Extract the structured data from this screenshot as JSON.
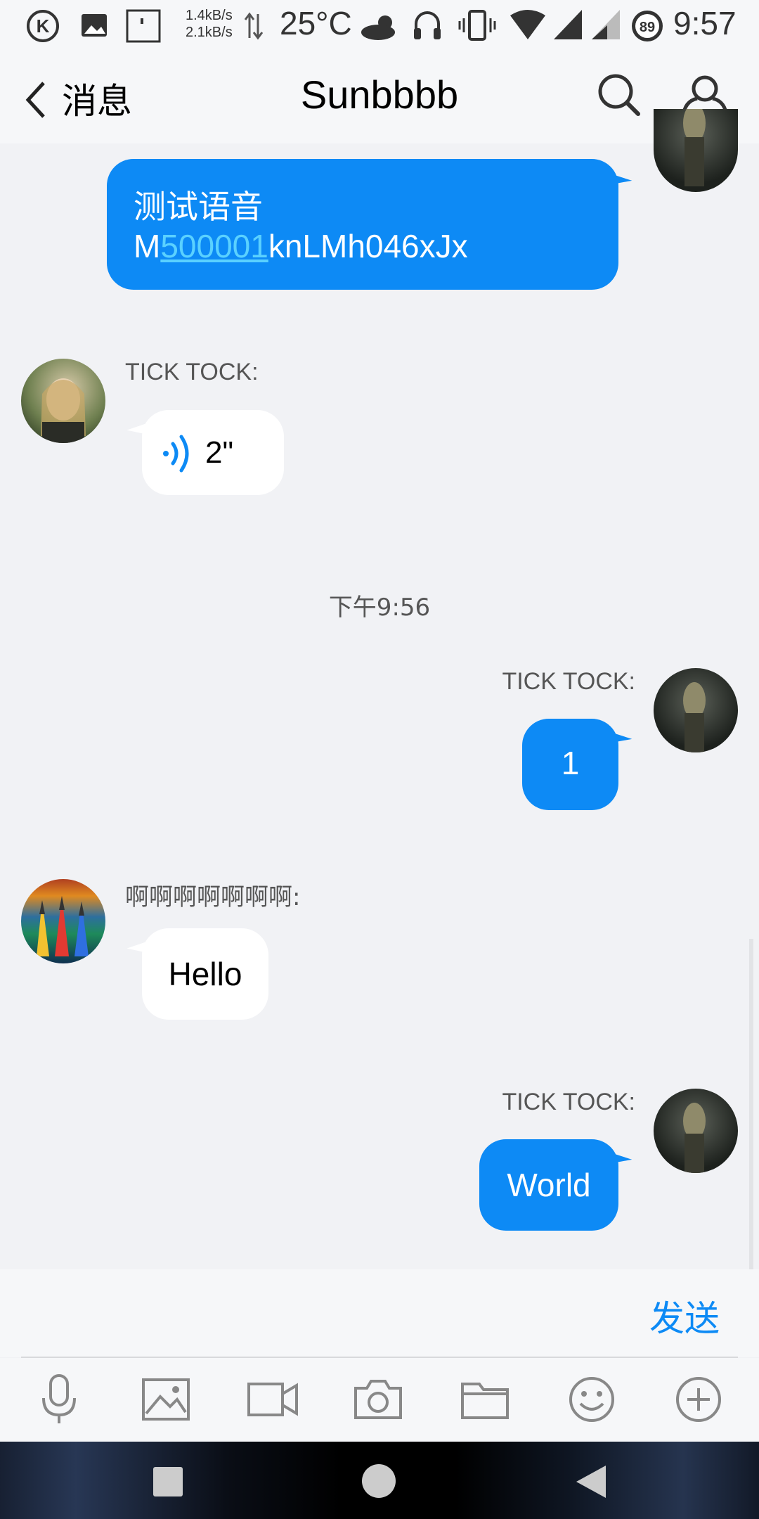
{
  "status_bar": {
    "net_up": "1.4kB/s",
    "net_down": "2.1kB/s",
    "temperature": "25°C",
    "battery": "89",
    "time": "9:57"
  },
  "header": {
    "back_label": "消息",
    "title": "Sunbbbb"
  },
  "messages": [
    {
      "direction": "out",
      "sender": "",
      "text_line1": "测试语音",
      "text_line2_prefix": "M",
      "text_line2_link": "500001",
      "text_line2_suffix": "knLMh046xJx"
    },
    {
      "direction": "in",
      "sender": "TICK TOCK:",
      "type": "voice",
      "duration": "2\""
    },
    {
      "direction": "time",
      "text": "下午9:56"
    },
    {
      "direction": "out",
      "sender": "TICK TOCK:",
      "text": "1"
    },
    {
      "direction": "in",
      "sender": "啊啊啊啊啊啊啊:",
      "text": "Hello"
    },
    {
      "direction": "out",
      "sender": "TICK TOCK:",
      "text": "World"
    }
  ],
  "input": {
    "send_label": "发送",
    "value": ""
  },
  "toolbar_icons": [
    "microphone-icon",
    "image-icon",
    "video-icon",
    "camera-icon",
    "folder-icon",
    "emoji-icon",
    "plus-icon"
  ],
  "colors": {
    "accent": "#0d8af5",
    "link": "#5ad1ff",
    "background": "#f1f2f5",
    "bar": "#f6f7f9"
  }
}
